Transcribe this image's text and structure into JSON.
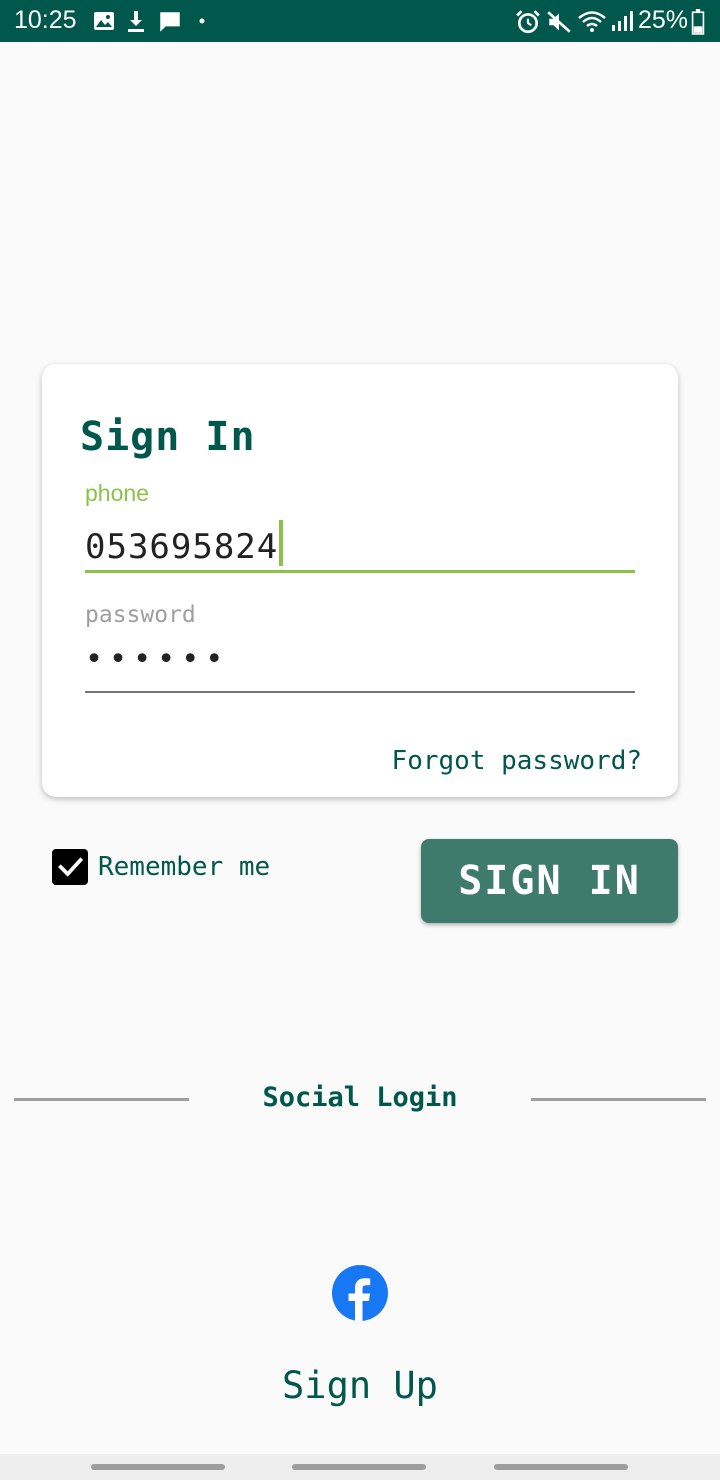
{
  "status_bar": {
    "time": "10:25",
    "battery": "25%",
    "icons": [
      "image-icon",
      "download-icon",
      "message-icon",
      "dot-icon",
      "alarm-icon",
      "mute-icon",
      "wifi-icon",
      "signal-icon",
      "battery-icon"
    ]
  },
  "signin_card": {
    "title": "Sign In",
    "phone": {
      "label": "phone",
      "value": "053695824"
    },
    "password": {
      "label": "password",
      "value": "••••••"
    },
    "forgot_password": "Forgot password?"
  },
  "remember_me": {
    "label": "Remember me",
    "checked": true
  },
  "signin_button": {
    "label": "SIGN IN"
  },
  "social": {
    "label": "Social Login",
    "providers": [
      "facebook-icon"
    ]
  },
  "signup": {
    "label": "Sign Up"
  },
  "colors": {
    "status_bar": "#00574b",
    "primary_text": "#00574b",
    "accent": "#8bc34a",
    "button": "#3f7b6d",
    "facebook": "#1877f2"
  }
}
